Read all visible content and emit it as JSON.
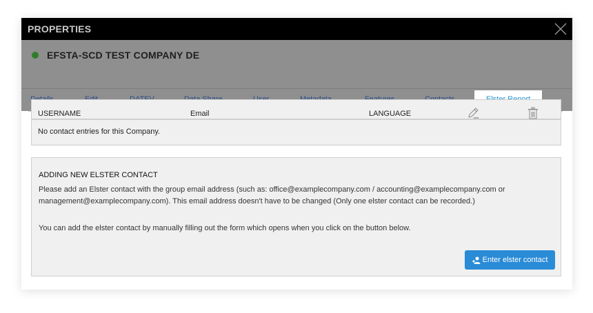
{
  "dialog": {
    "title": "PROPERTIES",
    "company_name": "EFSTA-SCD TEST COMPANY DE",
    "status_color": "#2f7d2a"
  },
  "tabs": [
    {
      "label": "Details",
      "active": false
    },
    {
      "label": "Edit",
      "active": false
    },
    {
      "label": "DATEV",
      "active": false
    },
    {
      "label": "Data Share",
      "active": false
    },
    {
      "label": "User",
      "active": false
    },
    {
      "label": "Metadata",
      "active": false
    },
    {
      "label": "Features",
      "active": false
    },
    {
      "label": "Contacts",
      "active": false
    },
    {
      "label": "Elster Report",
      "active": true
    }
  ],
  "contacts_table": {
    "columns": [
      "USERNAME",
      "Email",
      "LANGUAGE"
    ],
    "header_icons": [
      "edit-icon",
      "trash-icon"
    ],
    "empty_message": "No contact entries for this Company."
  },
  "add_section": {
    "title": "ADDING NEW ELSTER CONTACT",
    "description": "Please add an Elster contact with the group email address (such as: office@examplecompany.com / accounting@examplecompany.com or management@examplecompany.com). This email address doesn't have to be changed (Only one elster contact can be recorded.)",
    "instruction": "You can add the elster contact by manually filling out the form which opens when you click on the button below.",
    "button_label": "Enter elster contact",
    "button_icon": "add-user-icon"
  },
  "colors": {
    "accent": "#2196d3",
    "button": "#2a8bd6",
    "titlebar": "#000000",
    "header": "#8f8f8f"
  }
}
